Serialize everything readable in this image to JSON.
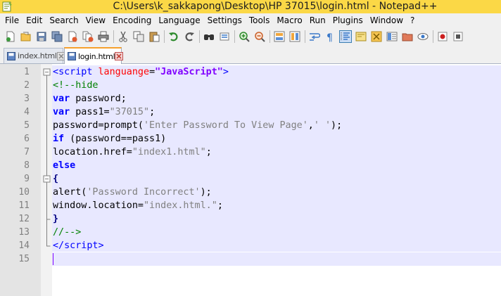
{
  "window": {
    "title": "C:\\Users\\k_sakkapong\\Desktop\\HP 37015\\login.html - Notepad++",
    "title_bar_color": "#fbd846"
  },
  "menu": [
    "File",
    "Edit",
    "Search",
    "View",
    "Encoding",
    "Language",
    "Settings",
    "Tools",
    "Macro",
    "Run",
    "Plugins",
    "Window",
    "?"
  ],
  "toolbar": {
    "icons": [
      "new-file-icon",
      "open-file-icon",
      "save-icon",
      "save-all-icon",
      "close-icon",
      "close-all-icon",
      "print-icon",
      "cut-icon",
      "copy-icon",
      "paste-icon",
      "undo-icon",
      "redo-icon",
      "find-icon",
      "replace-icon",
      "zoom-in-icon",
      "zoom-out-icon",
      "sync-vertical-icon",
      "sync-horizontal-icon",
      "word-wrap-icon",
      "show-all-characters-icon",
      "indent-guide-icon",
      "user-language-icon",
      "doc-map-icon",
      "function-list-icon",
      "folder-workspace-icon",
      "monitoring-icon",
      "record-macro-icon",
      "stop-record-icon"
    ],
    "active_icon": "indent-guide-icon"
  },
  "tabs": [
    {
      "label": "index.html",
      "active": false
    },
    {
      "label": "login.html",
      "active": true
    }
  ],
  "editor": {
    "lines": [
      {
        "n": "1",
        "fold": "box-open"
      },
      {
        "n": "2",
        "fold": "line"
      },
      {
        "n": "3",
        "fold": "line"
      },
      {
        "n": "4",
        "fold": "line"
      },
      {
        "n": "5",
        "fold": "line"
      },
      {
        "n": "6",
        "fold": "line"
      },
      {
        "n": "7",
        "fold": "line"
      },
      {
        "n": "8",
        "fold": "line"
      },
      {
        "n": "9",
        "fold": "box-open"
      },
      {
        "n": "10",
        "fold": "line"
      },
      {
        "n": "11",
        "fold": "line"
      },
      {
        "n": "12",
        "fold": "end"
      },
      {
        "n": "13",
        "fold": "line"
      },
      {
        "n": "14",
        "fold": "end"
      },
      {
        "n": "15",
        "fold": "none"
      }
    ],
    "code": {
      "l1": {
        "lt": "<",
        "tag": "script",
        "attr": " languange",
        "eq": "=",
        "val": "\"JavaScript\"",
        "gt": ">"
      },
      "l2": {
        "text": "<!--hide"
      },
      "l3": {
        "kw": "var",
        "rest": " password;"
      },
      "l4": {
        "kw": "var",
        "mid": " pass1=",
        "str": "\"37015\"",
        "end": ";"
      },
      "l5": {
        "a": "password=prompt(",
        "s1": "'Enter Password To View Page'",
        "b": ",",
        "s2": "' '",
        "c": ");"
      },
      "l6": {
        "kw": "if",
        "rest": " (password==pass1)"
      },
      "l7": {
        "a": "location.href=",
        "str": "\"index1.html\"",
        "end": ";"
      },
      "l8": {
        "kw": "else"
      },
      "l9": {
        "text": "{"
      },
      "l10": {
        "a": "alert(",
        "str": "'Password Incorrect'",
        "end": ");"
      },
      "l11": {
        "a": "window.location=",
        "str": "\"index.html.\"",
        "end": ";"
      },
      "l12": {
        "text": "}"
      },
      "l13": {
        "text": "//-->"
      },
      "l14": {
        "lt": "</",
        "tag": "script",
        "gt": ">"
      }
    },
    "caret_color": "#8000ff",
    "highlight_color": "#e8e8ff"
  }
}
